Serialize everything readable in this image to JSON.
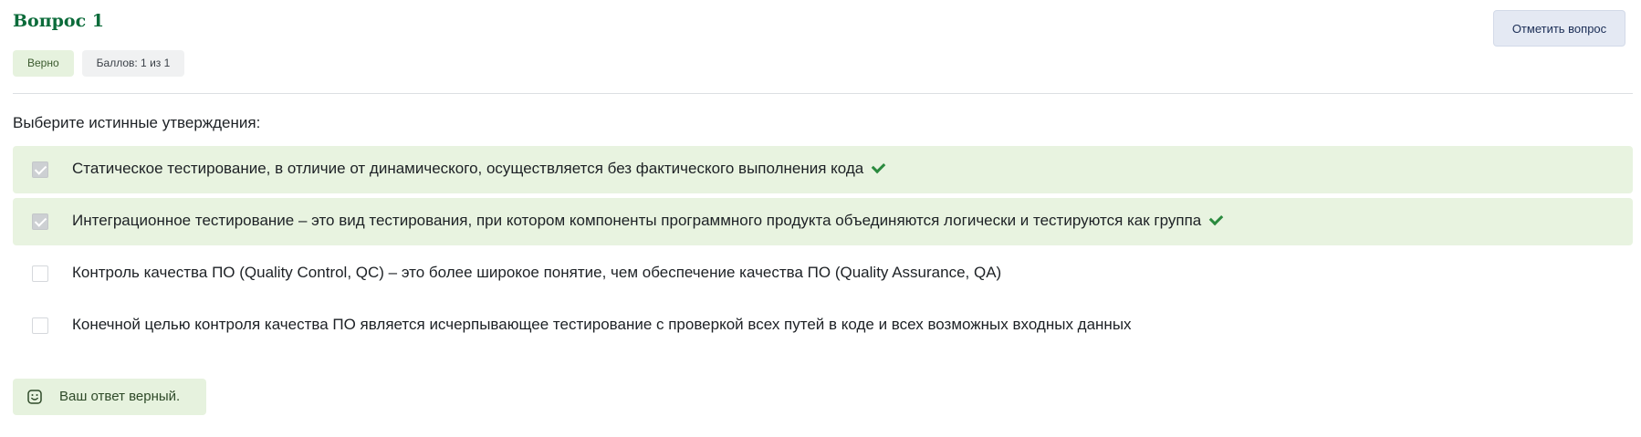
{
  "question": {
    "title": "Вопрос 1",
    "status_label": "Верно",
    "score_label": "Баллов: 1 из 1",
    "flag_button_label": "Отметить вопрос"
  },
  "prompt": "Выберите истинные утверждения:",
  "answers": [
    {
      "text": "Статическое тестирование, в отличие от динамического, осуществляется без фактического выполнения кода",
      "checked": true,
      "correct": true
    },
    {
      "text": "Интеграционное тестирование – это вид тестирования, при котором компоненты программного продукта объединяются логически и тестируются как группа",
      "checked": true,
      "correct": true
    },
    {
      "text": "Контроль качества ПО (Quality Control, QC) – это более широкое понятие, чем обеспечение качества ПО (Quality Assurance, QA)",
      "checked": false,
      "correct": false
    },
    {
      "text": "Конечной целью контроля качества ПО является исчерпывающее тестирование с проверкой всех путей в коде и всех возможных входных данных",
      "checked": false,
      "correct": false
    }
  ],
  "feedback": {
    "text": "Ваш ответ верный.",
    "icon": "smile-icon"
  },
  "colors": {
    "title": "#0b6b3a",
    "correct_bg": "#e8f3e0",
    "tick": "#2a8a3e",
    "flag_button_bg": "#e4e9f3"
  }
}
